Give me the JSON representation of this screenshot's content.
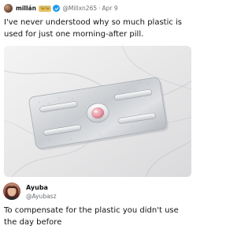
{
  "tweet": {
    "author_name": "millán",
    "badge_label": "🐝🐝",
    "handle": "@Millxn265",
    "separator": "·",
    "date": "Apr 9",
    "text": "I've never understood why so much plastic is used for just one morning-after pill."
  },
  "media": {
    "description_icon": "pill-blister-pack-icon"
  },
  "reply": {
    "author_name": "Ayuba",
    "handle": "@Ayubasz",
    "text": "To compensate for the plastic you didn't use the day before"
  },
  "colors": {
    "verified": "#1d9bf0",
    "handle_gray": "#6b6f74",
    "pill_pink": "#e79aa6"
  }
}
